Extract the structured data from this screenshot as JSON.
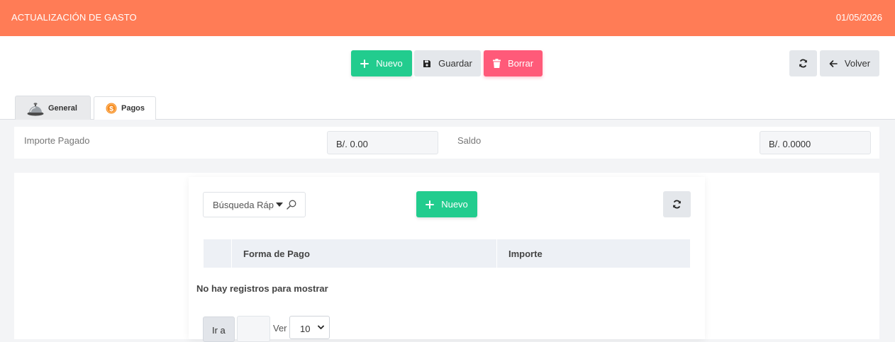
{
  "header": {
    "title": "ACTUALIZACIÓN DE GASTO",
    "date": "01/05/2026"
  },
  "toolbar": {
    "new_label": "Nuevo",
    "save_label": "Guardar",
    "delete_label": "Borrar",
    "back_label": "Volver"
  },
  "tabs": [
    {
      "label": "General",
      "icon": "bell-icon"
    },
    {
      "label": "Pagos",
      "icon": "dollar-coin-icon",
      "active": true
    }
  ],
  "fields": {
    "importe_pagado": {
      "label": "Importe Pagado",
      "value": "B/. 0.00"
    },
    "saldo": {
      "label": "Saldo",
      "value": "B/. 0.0000"
    }
  },
  "payments": {
    "search_placeholder": "Búsqueda Ráp",
    "new_label": "Nuevo",
    "columns": [
      "Forma de Pago",
      "Importe"
    ],
    "empty_message": "No hay registros para mostrar",
    "pager": {
      "goto_label": "Ir a",
      "goto_value": "",
      "view_label": "Ver",
      "page_size": "10"
    }
  },
  "colors": {
    "header": "#ff7c56",
    "primary": "#22cc8e",
    "danger": "#ff5a79",
    "neutral": "#e4e7eb"
  }
}
